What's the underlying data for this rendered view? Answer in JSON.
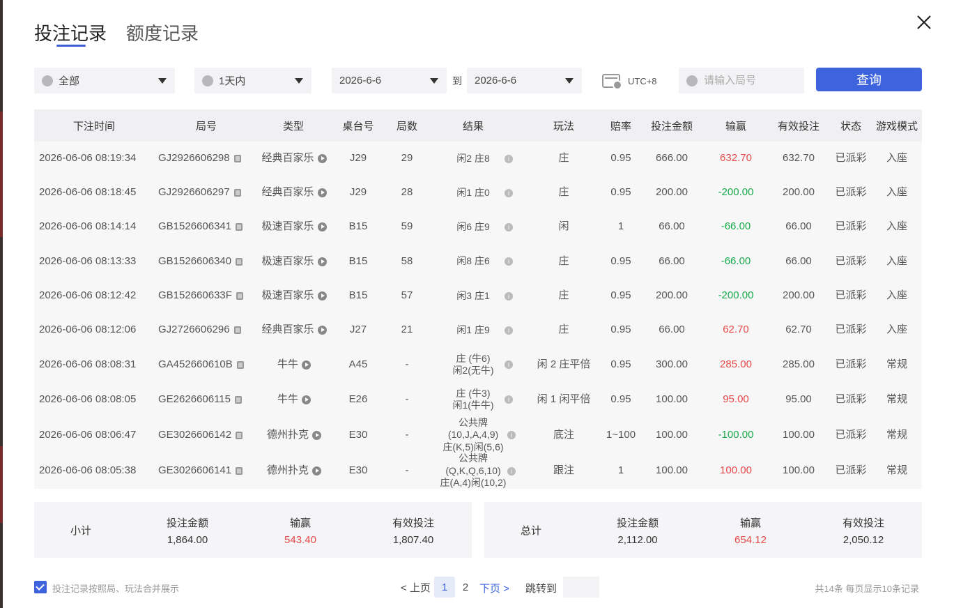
{
  "tabs": {
    "bet_records": "投注记录",
    "quota_records": "额度记录"
  },
  "filters": {
    "game_type": "全部",
    "time_range": "1天内",
    "date_from": "2026-6-6",
    "date_to": "2026-6-6",
    "to_label": "到",
    "timezone": "UTC+8",
    "round_placeholder": "请输入局号",
    "query_label": "查询"
  },
  "columns": [
    "下注时间",
    "局号",
    "类型",
    "桌台号",
    "局数",
    "结果",
    "玩法",
    "赔率",
    "投注金额",
    "输赢",
    "有效投注",
    "状态",
    "游戏模式"
  ],
  "rows": [
    {
      "time": "2026-06-06 08:19:34",
      "round": "GJ2926606298",
      "type": "经典百家乐",
      "table": "J29",
      "count": "29",
      "result": "闲2 庄8",
      "play": "庄",
      "odds": "0.95",
      "bet": "666.00",
      "win": "632.70",
      "win_sign": "pos",
      "valid": "632.70",
      "status": "已派彩",
      "mode": "入座"
    },
    {
      "time": "2026-06-06 08:18:45",
      "round": "GJ2926606297",
      "type": "经典百家乐",
      "table": "J29",
      "count": "28",
      "result": "闲1 庄0",
      "play": "庄",
      "odds": "0.95",
      "bet": "200.00",
      "win": "-200.00",
      "win_sign": "neg",
      "valid": "200.00",
      "status": "已派彩",
      "mode": "入座"
    },
    {
      "time": "2026-06-06 08:14:14",
      "round": "GB1526606341",
      "type": "极速百家乐",
      "table": "B15",
      "count": "59",
      "result": "闲6 庄9",
      "play": "闲",
      "odds": "1",
      "bet": "66.00",
      "win": "-66.00",
      "win_sign": "neg",
      "valid": "66.00",
      "status": "已派彩",
      "mode": "入座"
    },
    {
      "time": "2026-06-06 08:13:33",
      "round": "GB1526606340",
      "type": "极速百家乐",
      "table": "B15",
      "count": "58",
      "result": "闲8 庄6",
      "play": "庄",
      "odds": "0.95",
      "bet": "66.00",
      "win": "-66.00",
      "win_sign": "neg",
      "valid": "66.00",
      "status": "已派彩",
      "mode": "入座"
    },
    {
      "time": "2026-06-06 08:12:42",
      "round": "GB152660633F",
      "type": "极速百家乐",
      "table": "B15",
      "count": "57",
      "result": "闲3 庄1",
      "play": "庄",
      "odds": "0.95",
      "bet": "200.00",
      "win": "-200.00",
      "win_sign": "neg",
      "valid": "200.00",
      "status": "已派彩",
      "mode": "入座"
    },
    {
      "time": "2026-06-06 08:12:06",
      "round": "GJ2726606296",
      "type": "经典百家乐",
      "table": "J27",
      "count": "21",
      "result": "闲1 庄9",
      "play": "庄",
      "odds": "0.95",
      "bet": "66.00",
      "win": "62.70",
      "win_sign": "pos",
      "valid": "62.70",
      "status": "已派彩",
      "mode": "入座"
    },
    {
      "time": "2026-06-06 08:08:31",
      "round": "GA452660610B",
      "type": "牛牛",
      "table": "A45",
      "count": "-",
      "result": "庄 (牛6)\n闲2(无牛)",
      "play": "闲 2 庄平倍",
      "odds": "0.95",
      "bet": "300.00",
      "win": "285.00",
      "win_sign": "pos",
      "valid": "285.00",
      "status": "已派彩",
      "mode": "常规"
    },
    {
      "time": "2026-06-06 08:08:05",
      "round": "GE2626606115",
      "type": "牛牛",
      "table": "E26",
      "count": "-",
      "result": "庄 (牛3)\n闲1(牛牛)",
      "play": "闲 1 闲平倍",
      "odds": "0.95",
      "bet": "100.00",
      "win": "95.00",
      "win_sign": "pos",
      "valid": "95.00",
      "status": "已派彩",
      "mode": "常规"
    },
    {
      "time": "2026-06-06 08:06:47",
      "round": "GE3026606142",
      "type": "德州扑克",
      "table": "E30",
      "count": "-",
      "result": "公共牌\n(10,J,A,4,9)\n庄(K,5)闲(5,6)",
      "play": "底注",
      "odds": "1~100",
      "bet": "100.00",
      "win": "-100.00",
      "win_sign": "neg",
      "valid": "100.00",
      "status": "已派彩",
      "mode": "常规"
    },
    {
      "time": "2026-06-06 08:05:38",
      "round": "GE3026606141",
      "type": "德州扑克",
      "table": "E30",
      "count": "-",
      "result": "公共牌\n(Q,K,Q,6,10)\n庄(A,4)闲(10,2)",
      "play": "跟注",
      "odds": "1",
      "bet": "100.00",
      "win": "100.00",
      "win_sign": "pos",
      "valid": "100.00",
      "status": "已派彩",
      "mode": "常规"
    }
  ],
  "subtotal": {
    "label": "小计",
    "bet_label": "投注金额",
    "bet": "1,864.00",
    "win_label": "输赢",
    "win": "543.40",
    "valid_label": "有效投注",
    "valid": "1,807.40"
  },
  "total": {
    "label": "总计",
    "bet_label": "投注金额",
    "bet": "2,112.00",
    "win_label": "输赢",
    "win": "654.12",
    "valid_label": "有效投注",
    "valid": "2,050.12"
  },
  "footer": {
    "merge_label": "投注记录按照局、玩法合并展示",
    "prev": "< 上页",
    "pages": [
      "1",
      "2"
    ],
    "next": "下页 >",
    "jump": "跳转到",
    "info": "共14条  每页显示10条记录"
  },
  "colors": {
    "accent": "#3d63dd",
    "win": "#e84a4a",
    "loss": "#1aaa4a"
  }
}
